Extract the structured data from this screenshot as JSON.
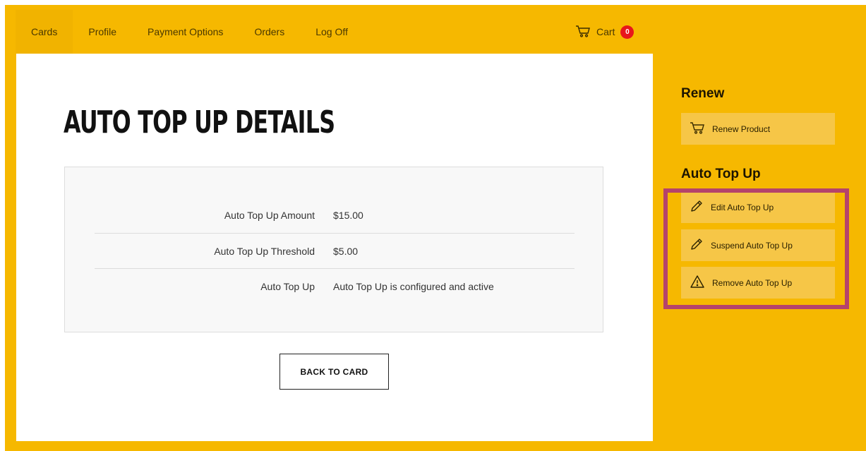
{
  "nav": {
    "items": [
      "Cards",
      "Profile",
      "Payment Options",
      "Orders",
      "Log Off"
    ],
    "cart_label": "Cart",
    "cart_count": "0"
  },
  "main": {
    "title": "AUTO TOP UP DETAILS",
    "details": [
      {
        "label": "Auto Top Up Amount",
        "value": "$15.00"
      },
      {
        "label": "Auto Top Up Threshold",
        "value": "$5.00"
      },
      {
        "label": "Auto Top Up",
        "value": "Auto Top Up is configured and active"
      }
    ],
    "back_button": "BACK TO CARD"
  },
  "sidebar": {
    "renew_heading": "Renew",
    "renew_button": "Renew Product",
    "auto_heading": "Auto Top Up",
    "edit_button": "Edit Auto Top Up",
    "suspend_button": "Suspend Auto Top Up",
    "remove_button": "Remove Auto Top Up"
  },
  "colors": {
    "background": "#f6b800",
    "sidebar_button": "#f6c647",
    "badge": "#e8161b",
    "highlight": "#b5436b"
  },
  "icons": {
    "cart": "cart-icon",
    "pencil": "pencil-icon",
    "warning": "warning-icon"
  }
}
